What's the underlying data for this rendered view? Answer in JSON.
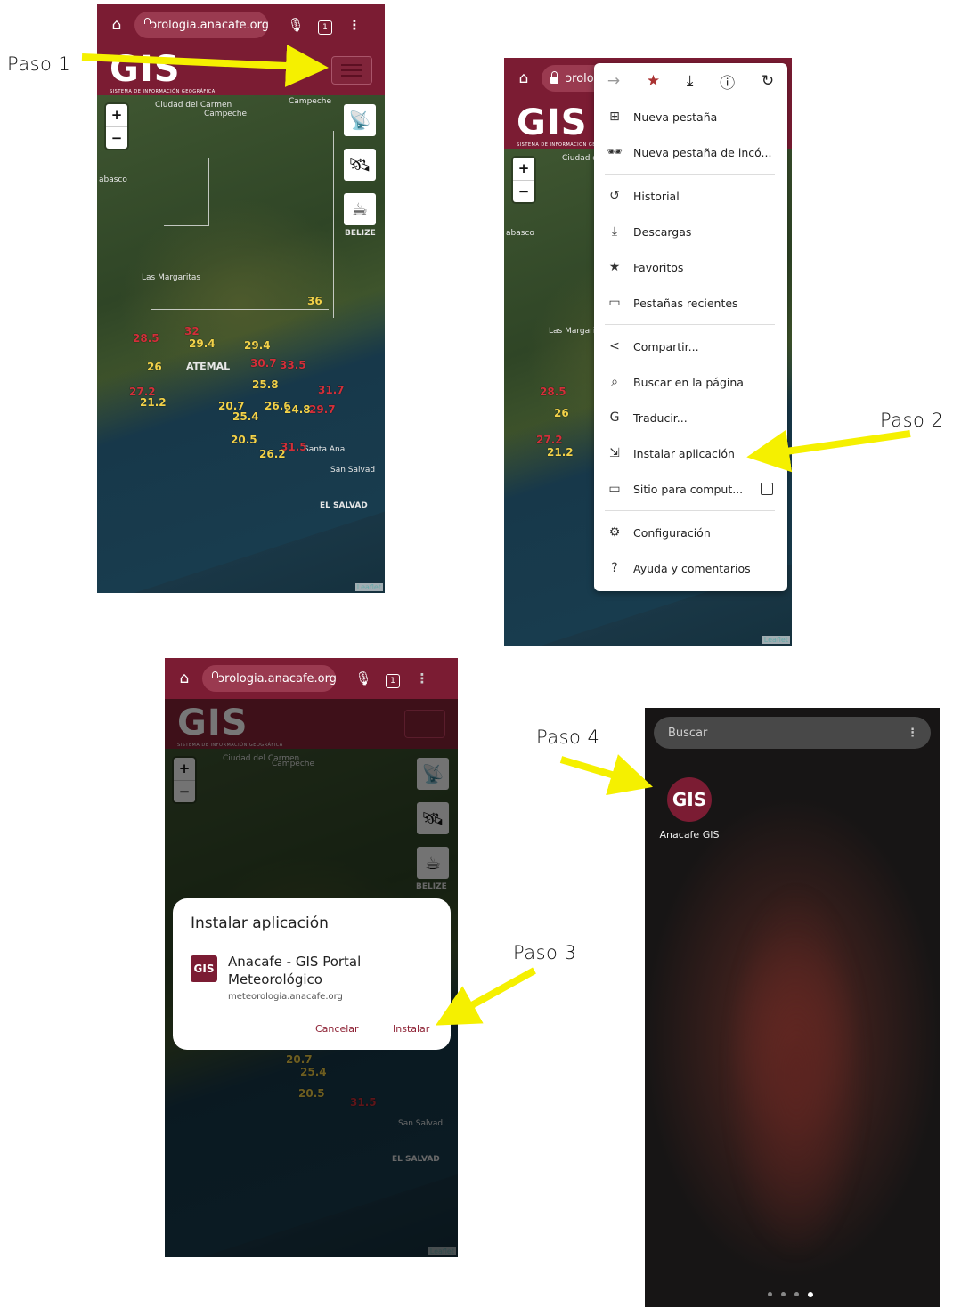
{
  "steps": {
    "step1": "Paso 1",
    "step2": "Paso 2",
    "step3": "Paso 3",
    "step4": "Paso 4"
  },
  "browser": {
    "url": "ɔrologia.anacafe.org",
    "url_short": "ɔrolo",
    "tab_count": "1"
  },
  "site": {
    "logo": "GIS",
    "logo_sub": "SISTEMA DE INFORMACIÓN GEOGRÁFICA"
  },
  "map": {
    "zoom_in": "+",
    "zoom_out": "−",
    "places": [
      "Ciudad del Carmen",
      "Campeche",
      "Campeche",
      "abasco",
      "BELIZE",
      "Las Margaritas",
      "ATEMAL",
      "Santa Ana",
      "San Salvad",
      "EL SALVAD"
    ],
    "attribution": "Leaflet",
    "temps": [
      "36",
      "32",
      "29.4",
      "29.4",
      "28.5",
      "26",
      "30.7",
      "33.5",
      "25.8",
      "31.7",
      "27.2",
      "21.2",
      "29.7",
      "20.7",
      "26.6",
      "24.8",
      "25.4",
      "31.5",
      "20.5",
      "26.2"
    ]
  },
  "menu": {
    "top_icons": [
      "arrow-forward-icon",
      "star-icon",
      "download-icon",
      "info-icon",
      "refresh-icon"
    ],
    "items": [
      {
        "label": "Nueva pestaña",
        "icon": "⊞"
      },
      {
        "label": "Nueva pestaña de incó...",
        "icon": "🕶"
      },
      {
        "label": "Historial",
        "icon": "↺"
      },
      {
        "label": "Descargas",
        "icon": "⤓"
      },
      {
        "label": "Favoritos",
        "icon": "★"
      },
      {
        "label": "Pestañas recientes",
        "icon": "▭"
      },
      {
        "label": "Compartir...",
        "icon": "<"
      },
      {
        "label": "Buscar en la página",
        "icon": "⌕"
      },
      {
        "label": "Traducir...",
        "icon": "G"
      },
      {
        "label": "Instalar aplicación",
        "icon": "⇲"
      },
      {
        "label": "Sitio para comput...",
        "icon": "▭"
      },
      {
        "label": "Configuración",
        "icon": "⚙"
      },
      {
        "label": "Ayuda y comentarios",
        "icon": "?"
      }
    ]
  },
  "dialog": {
    "title": "Instalar aplicación",
    "app_name_line1": "Anacafe - GIS Portal",
    "app_name_line2": "Meteorológico",
    "app_url": "meteorologia.anacafe.org",
    "cancel": "Cancelar",
    "install": "Instalar"
  },
  "launcher": {
    "search_placeholder": "Buscar",
    "app_label": "Anacafe GIS",
    "page_dots": 4,
    "active_dot": 4
  },
  "colors": {
    "brand": "#7b1c33",
    "arrow": "#f5f000",
    "accent_red": "#c9343e"
  }
}
